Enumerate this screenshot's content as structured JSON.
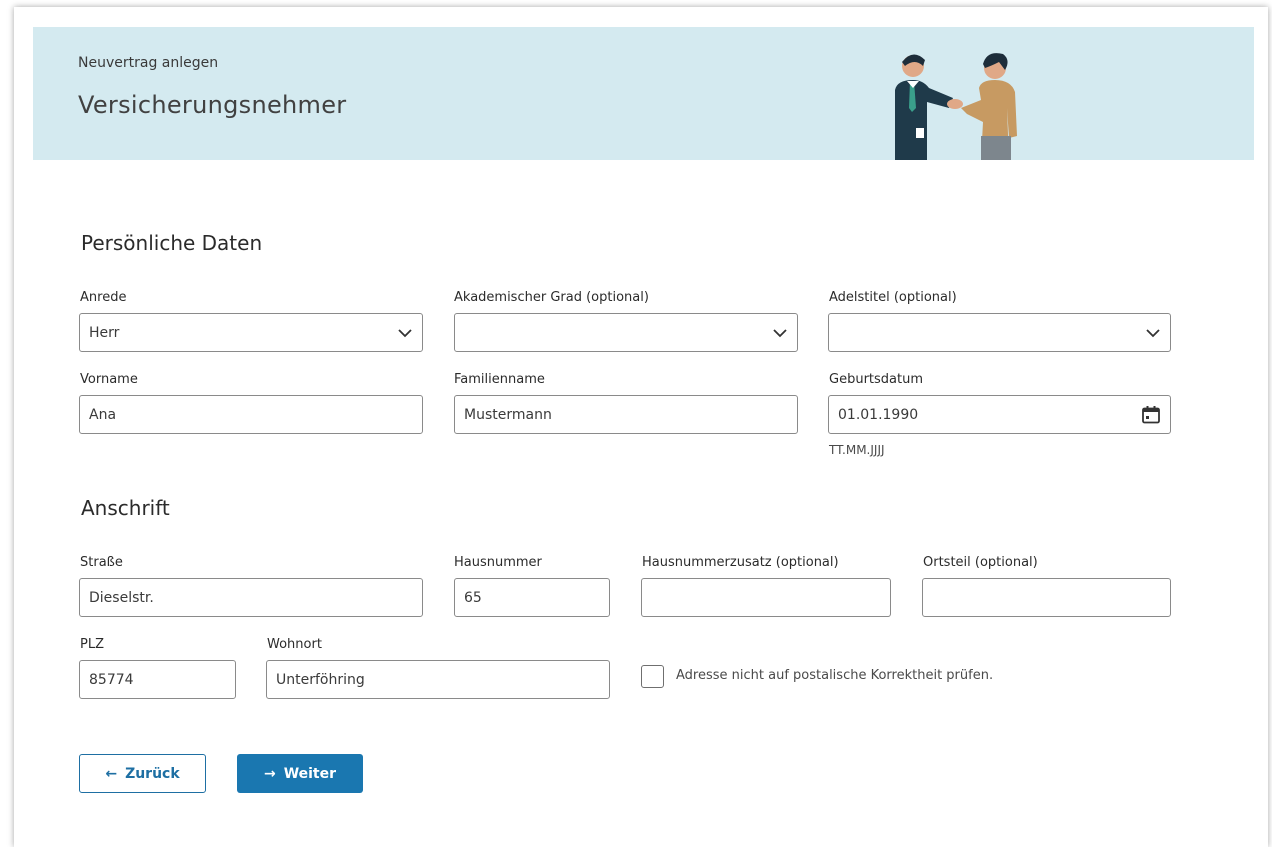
{
  "header": {
    "eyebrow": "Neuvertrag anlegen",
    "title": "Versicherungsnehmer"
  },
  "personal": {
    "section_title": "Persönliche Daten",
    "anrede": {
      "label": "Anrede",
      "value": "Herr"
    },
    "akad_grad": {
      "label": "Akademischer Grad (optional)",
      "value": ""
    },
    "adelstitel": {
      "label": "Adelstitel (optional)",
      "value": ""
    },
    "vorname": {
      "label": "Vorname",
      "value": "Ana"
    },
    "familienname": {
      "label": "Familienname",
      "value": "Mustermann"
    },
    "geburtsdatum": {
      "label": "Geburtsdatum",
      "value": "01.01.1990",
      "hint": "TT.MM.JJJJ"
    }
  },
  "address": {
    "section_title": "Anschrift",
    "strasse": {
      "label": "Straße",
      "value": "Dieselstr."
    },
    "hausnummer": {
      "label": "Hausnummer",
      "value": "65"
    },
    "hausnummerzusatz": {
      "label": "Hausnummerzusatz (optional)",
      "value": ""
    },
    "ortsteil": {
      "label": "Ortsteil (optional)",
      "value": ""
    },
    "plz": {
      "label": "PLZ",
      "value": "85774"
    },
    "wohnort": {
      "label": "Wohnort",
      "value": "Unterföhring"
    },
    "no_check": {
      "label": "Adresse nicht auf postalische Korrektheit prüfen.",
      "checked": false
    }
  },
  "actions": {
    "back_label": "Zurück",
    "next_label": "Weiter"
  },
  "colors": {
    "header_bg": "#d4eaf0",
    "primary": "#1a77b0"
  }
}
